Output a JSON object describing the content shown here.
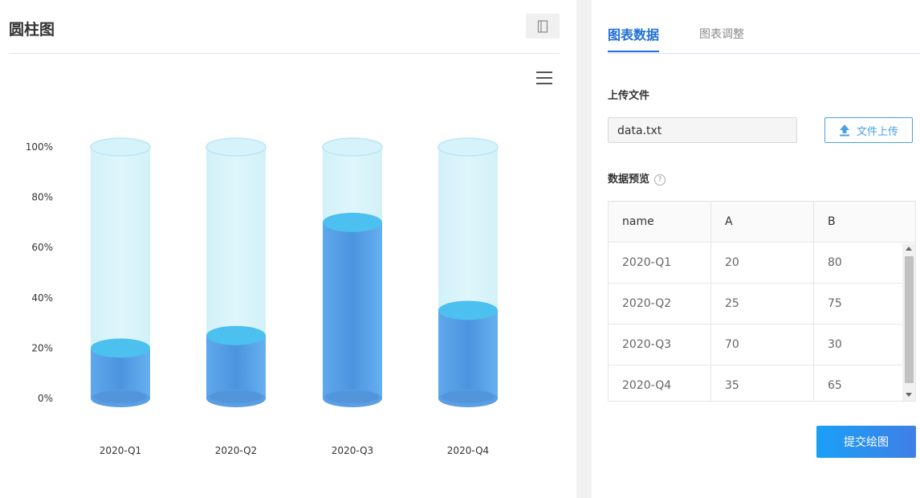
{
  "header": {
    "title": "圆柱图"
  },
  "chart_data": {
    "type": "bar",
    "categories": [
      "2020-Q1",
      "2020-Q2",
      "2020-Q3",
      "2020-Q4"
    ],
    "series": [
      {
        "name": "A",
        "values": [
          20,
          25,
          70,
          35
        ]
      },
      {
        "name": "B",
        "values": [
          80,
          75,
          30,
          65
        ]
      }
    ],
    "stacked": true,
    "style": "3d-cylinder",
    "ylim": [
      0,
      100
    ],
    "yticks": [
      "0%",
      "20%",
      "40%",
      "60%",
      "80%",
      "100%"
    ],
    "colors": {
      "fill": "#5aa6ec",
      "fill_dark": "#4a8fd6",
      "top": "#4fc3f0",
      "background": "#d6f3f9"
    },
    "grid": false
  },
  "panel": {
    "tabs": [
      {
        "label": "图表数据",
        "active": true
      },
      {
        "label": "图表调整",
        "active": false
      }
    ],
    "upload_label": "上传文件",
    "file_name": "data.txt",
    "upload_button": "文件上传",
    "preview_label": "数据预览",
    "help_glyph": "?",
    "table": {
      "columns": [
        "name",
        "A",
        "B"
      ],
      "rows": [
        [
          "2020-Q1",
          "20",
          "80"
        ],
        [
          "2020-Q2",
          "25",
          "75"
        ],
        [
          "2020-Q3",
          "70",
          "30"
        ],
        [
          "2020-Q4",
          "35",
          "65"
        ]
      ]
    },
    "submit_button": "提交绘图",
    "accent_color": "#1f6fd6"
  }
}
